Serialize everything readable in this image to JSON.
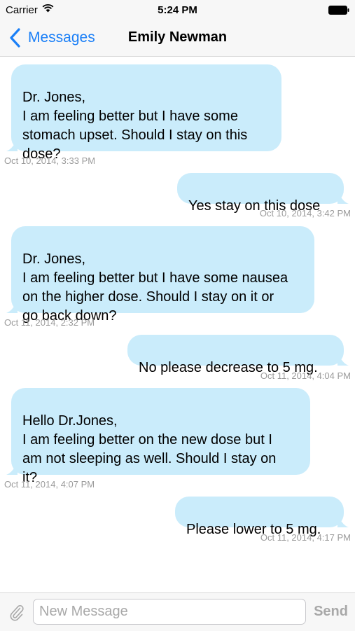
{
  "status_bar": {
    "carrier": "Carrier",
    "time": "5:24 PM",
    "icons": [
      "wifi-icon",
      "battery-icon"
    ]
  },
  "nav_bar": {
    "back_label": "Messages",
    "title": "Emily Newman",
    "accent_color": "#1a7ff7"
  },
  "messages": [
    {
      "direction": "incoming",
      "text": "Dr. Jones,\nI am feeling better but I have some\nstomach upset. Should I stay on this\ndose?",
      "timestamp": "Oct 10, 2014, 3:33 PM"
    },
    {
      "direction": "outgoing",
      "text": "Yes stay on this dose",
      "timestamp": "Oct 10, 2014, 3:42 PM"
    },
    {
      "direction": "incoming",
      "text": "Dr. Jones,\nI am feeling better but I have some nausea\non the higher dose.  Should I stay on it or\ngo back down?",
      "timestamp": "Oct 11, 2014, 2:32 PM"
    },
    {
      "direction": "outgoing",
      "text": "No please decrease to 5 mg.",
      "timestamp": "Oct 11, 2014, 4:04 PM"
    },
    {
      "direction": "incoming",
      "text": "Hello Dr.Jones,\nI am feeling better on the new dose but I\nam not sleeping as well. Should I stay on\nit?",
      "timestamp": "Oct 11, 2014, 4:07 PM"
    },
    {
      "direction": "outgoing",
      "text": "Please lower to 5 mg.",
      "timestamp": "Oct 11, 2014, 4:17 PM"
    }
  ],
  "bubble_color": "#caecfb",
  "input_bar": {
    "placeholder": "New Message",
    "value": "",
    "send_label": "Send",
    "attach_icon": "paperclip-icon"
  }
}
